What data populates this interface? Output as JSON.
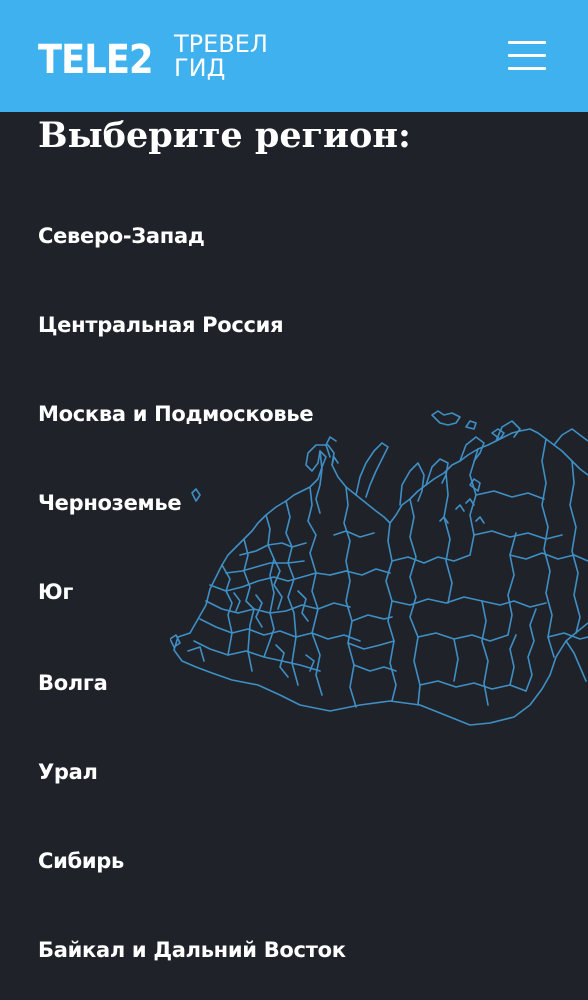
{
  "header": {
    "logo_text": "TELE2",
    "subtitle_line1": "ТРЕВЕЛ",
    "subtitle_line2": "ГИД",
    "menu_icon": "hamburger-menu-icon"
  },
  "main": {
    "title": "Выберите регион:",
    "regions": [
      {
        "label": "Северо-Запад"
      },
      {
        "label": "Центральная Россия"
      },
      {
        "label": "Москва и Подмосковье"
      },
      {
        "label": "Черноземье"
      },
      {
        "label": "Юг"
      },
      {
        "label": "Волга"
      },
      {
        "label": "Урал"
      },
      {
        "label": "Сибирь"
      },
      {
        "label": "Байкал и Дальний Восток"
      }
    ],
    "map_image": "russia-regions-map"
  },
  "colors": {
    "header_bg": "#3fb1ee",
    "page_bg": "#1f2229",
    "map_stroke": "#3f8fc4",
    "text": "#ffffff"
  }
}
